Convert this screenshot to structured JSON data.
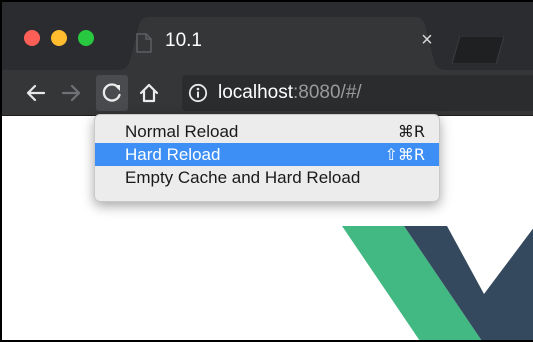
{
  "window": {
    "controls": [
      "close",
      "minimize",
      "maximize"
    ]
  },
  "tab": {
    "title": "10.1",
    "close_glyph": "×",
    "icon": "page-icon"
  },
  "toolbar": {
    "back_icon": "arrow-left-icon",
    "forward_icon": "arrow-right-icon",
    "reload_icon": "reload-icon",
    "home_icon": "home-icon",
    "url_host": "localhost",
    "url_rest": ":8080/#/"
  },
  "context_menu": {
    "items": [
      {
        "label": "Normal Reload",
        "shortcut": "⌘R",
        "selected": false
      },
      {
        "label": "Hard Reload",
        "shortcut": "⇧⌘R",
        "selected": true
      },
      {
        "label": "Empty Cache and Hard Reload",
        "shortcut": "",
        "selected": false
      }
    ]
  },
  "colors": {
    "titlebar": "#2b2c2f",
    "toolbar": "#353638",
    "menu_highlight": "#3d8ff6",
    "vue_green": "#42b883",
    "vue_dark": "#35495e"
  }
}
